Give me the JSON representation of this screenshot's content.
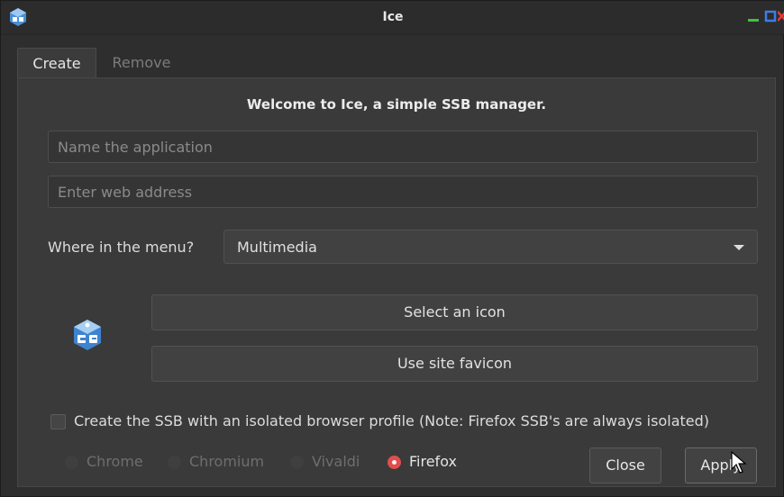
{
  "window": {
    "title": "Ice",
    "app_icon": "ice-logo-icon",
    "controls": {
      "minimize": "minimize-icon",
      "maximize": "maximize-icon",
      "close": "close-icon"
    }
  },
  "tabs": [
    {
      "label": "Create",
      "active": true
    },
    {
      "label": "Remove",
      "active": false
    }
  ],
  "create": {
    "welcome": "Welcome to Ice, a simple SSB manager.",
    "name_field": {
      "placeholder": "Name the application",
      "value": ""
    },
    "url_field": {
      "placeholder": "Enter web address",
      "value": ""
    },
    "menu_label": "Where in the menu?",
    "menu_selected": "Multimedia",
    "select_icon_label": "Select an icon",
    "favicon_label": "Use site favicon",
    "isolated_profile_label": "Create the SSB with an isolated browser profile (Note: Firefox SSB's are always isolated)",
    "isolated_profile_checked": false,
    "browsers": [
      {
        "label": "Chrome",
        "enabled": false,
        "selected": false
      },
      {
        "label": "Chromium",
        "enabled": false,
        "selected": false
      },
      {
        "label": "Vivaldi",
        "enabled": false,
        "selected": false
      },
      {
        "label": "Firefox",
        "enabled": true,
        "selected": true
      }
    ],
    "close_label": "Close",
    "apply_label": "Apply"
  },
  "colors": {
    "background": "#2e2e2e",
    "panel": "#3a3a3a",
    "radio_selected": "#e24d4d",
    "minimize": "#3cc43c",
    "maximize": "#3b7de8",
    "close": "#e23b3b"
  }
}
